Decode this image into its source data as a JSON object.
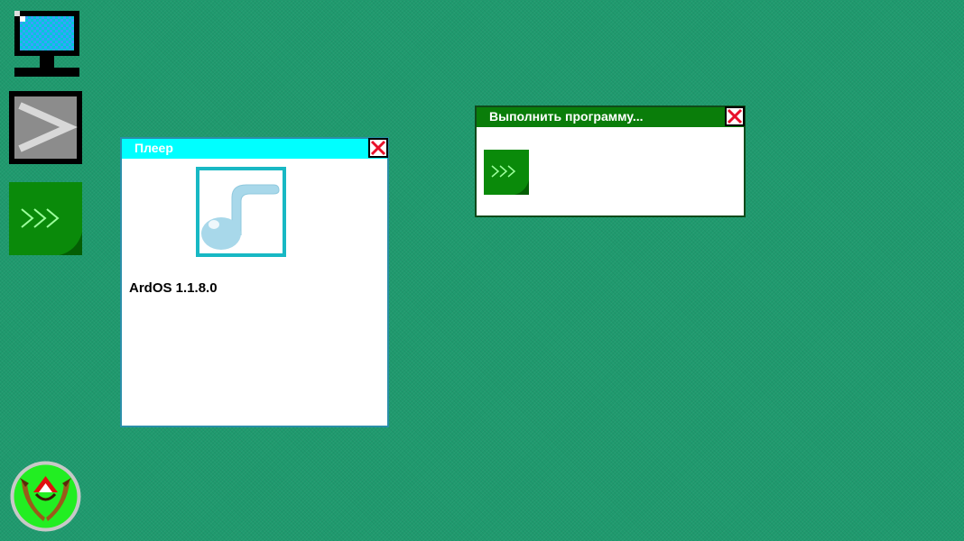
{
  "desktop": {
    "icons": [
      {
        "name": "computer-icon"
      },
      {
        "name": "terminal-icon"
      },
      {
        "name": "run-program-icon"
      },
      {
        "name": "start-menu-logo"
      }
    ],
    "colors": {
      "background": "#1f9a6e"
    }
  },
  "windows": {
    "player": {
      "title": "Плеер",
      "version": "ArdOS 1.1.8.0",
      "title_color": "#00ffff"
    },
    "run": {
      "title": "Выполнить программу...",
      "title_color": "#0a7d0a"
    }
  }
}
